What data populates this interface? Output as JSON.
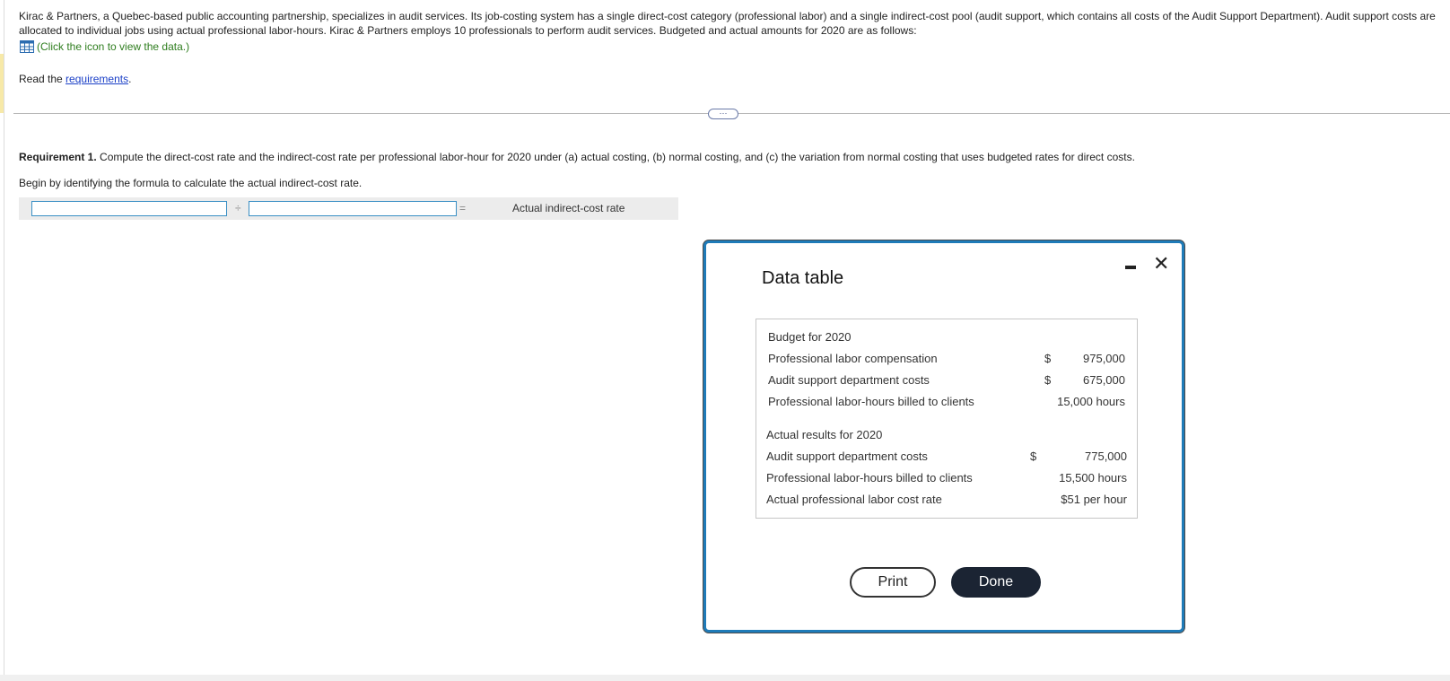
{
  "intro": {
    "paragraph": "Kirac & Partners, a Quebec-based public accounting partnership, specializes in audit services. Its job-costing system has a single direct-cost category (professional labor) and a single indirect-cost pool (audit support, which contains all costs of the Audit Support Department). Audit support costs are allocated to individual jobs using actual professional labor-hours. Kirac & Partners employs 10 professionals to perform audit services. Budgeted and actual amounts for 2020 are as follows:",
    "data_link": "(Click the icon to view the data.)",
    "read_prefix": "Read the ",
    "read_link": "requirements",
    "read_suffix": "."
  },
  "expand_label": "···",
  "requirement": {
    "bold": "Requirement 1.",
    "text": " Compute the direct-cost rate and the indirect-cost rate per professional labor-hour for 2020 under (a) actual costing, (b) normal costing, and (c) the variation from normal costing that uses budgeted rates for direct costs.",
    "begin": "Begin by identifying the formula to calculate the actual indirect-cost rate."
  },
  "formula": {
    "input1_value": "",
    "operator_divide": "÷",
    "input2_value": "",
    "operator_equals": "=",
    "result_label": "Actual indirect-cost rate"
  },
  "modal": {
    "title": "Data table",
    "minimize_icon": "minimize-icon",
    "close_glyph": "✕",
    "print_label": "Print",
    "done_label": "Done",
    "table": {
      "budget_header": "Budget for 2020",
      "budget_rows": [
        {
          "label": "Professional labor compensation",
          "dollar": "$",
          "value": "975,000"
        },
        {
          "label": "Audit support department costs",
          "dollar": "$",
          "value": "675,000"
        },
        {
          "label": "Professional labor-hours billed to clients",
          "dollar": "",
          "value": "15,000 hours"
        }
      ],
      "actual_header": "Actual results for 2020",
      "actual_rows": [
        {
          "label": "Audit support department costs",
          "dollar": "$",
          "value": "775,000"
        },
        {
          "label": "Professional labor-hours billed to clients",
          "dollar": "",
          "value": "15,500 hours"
        },
        {
          "label": "Actual professional labor cost rate",
          "dollar": "",
          "value": "$51 per hour"
        }
      ]
    }
  },
  "colors": {
    "link_green": "#2e7d1e",
    "link_blue": "#1a3fc7",
    "modal_border": "#1f7bb8",
    "done_button": "#1b2433",
    "input_border": "#3a8fc4"
  }
}
